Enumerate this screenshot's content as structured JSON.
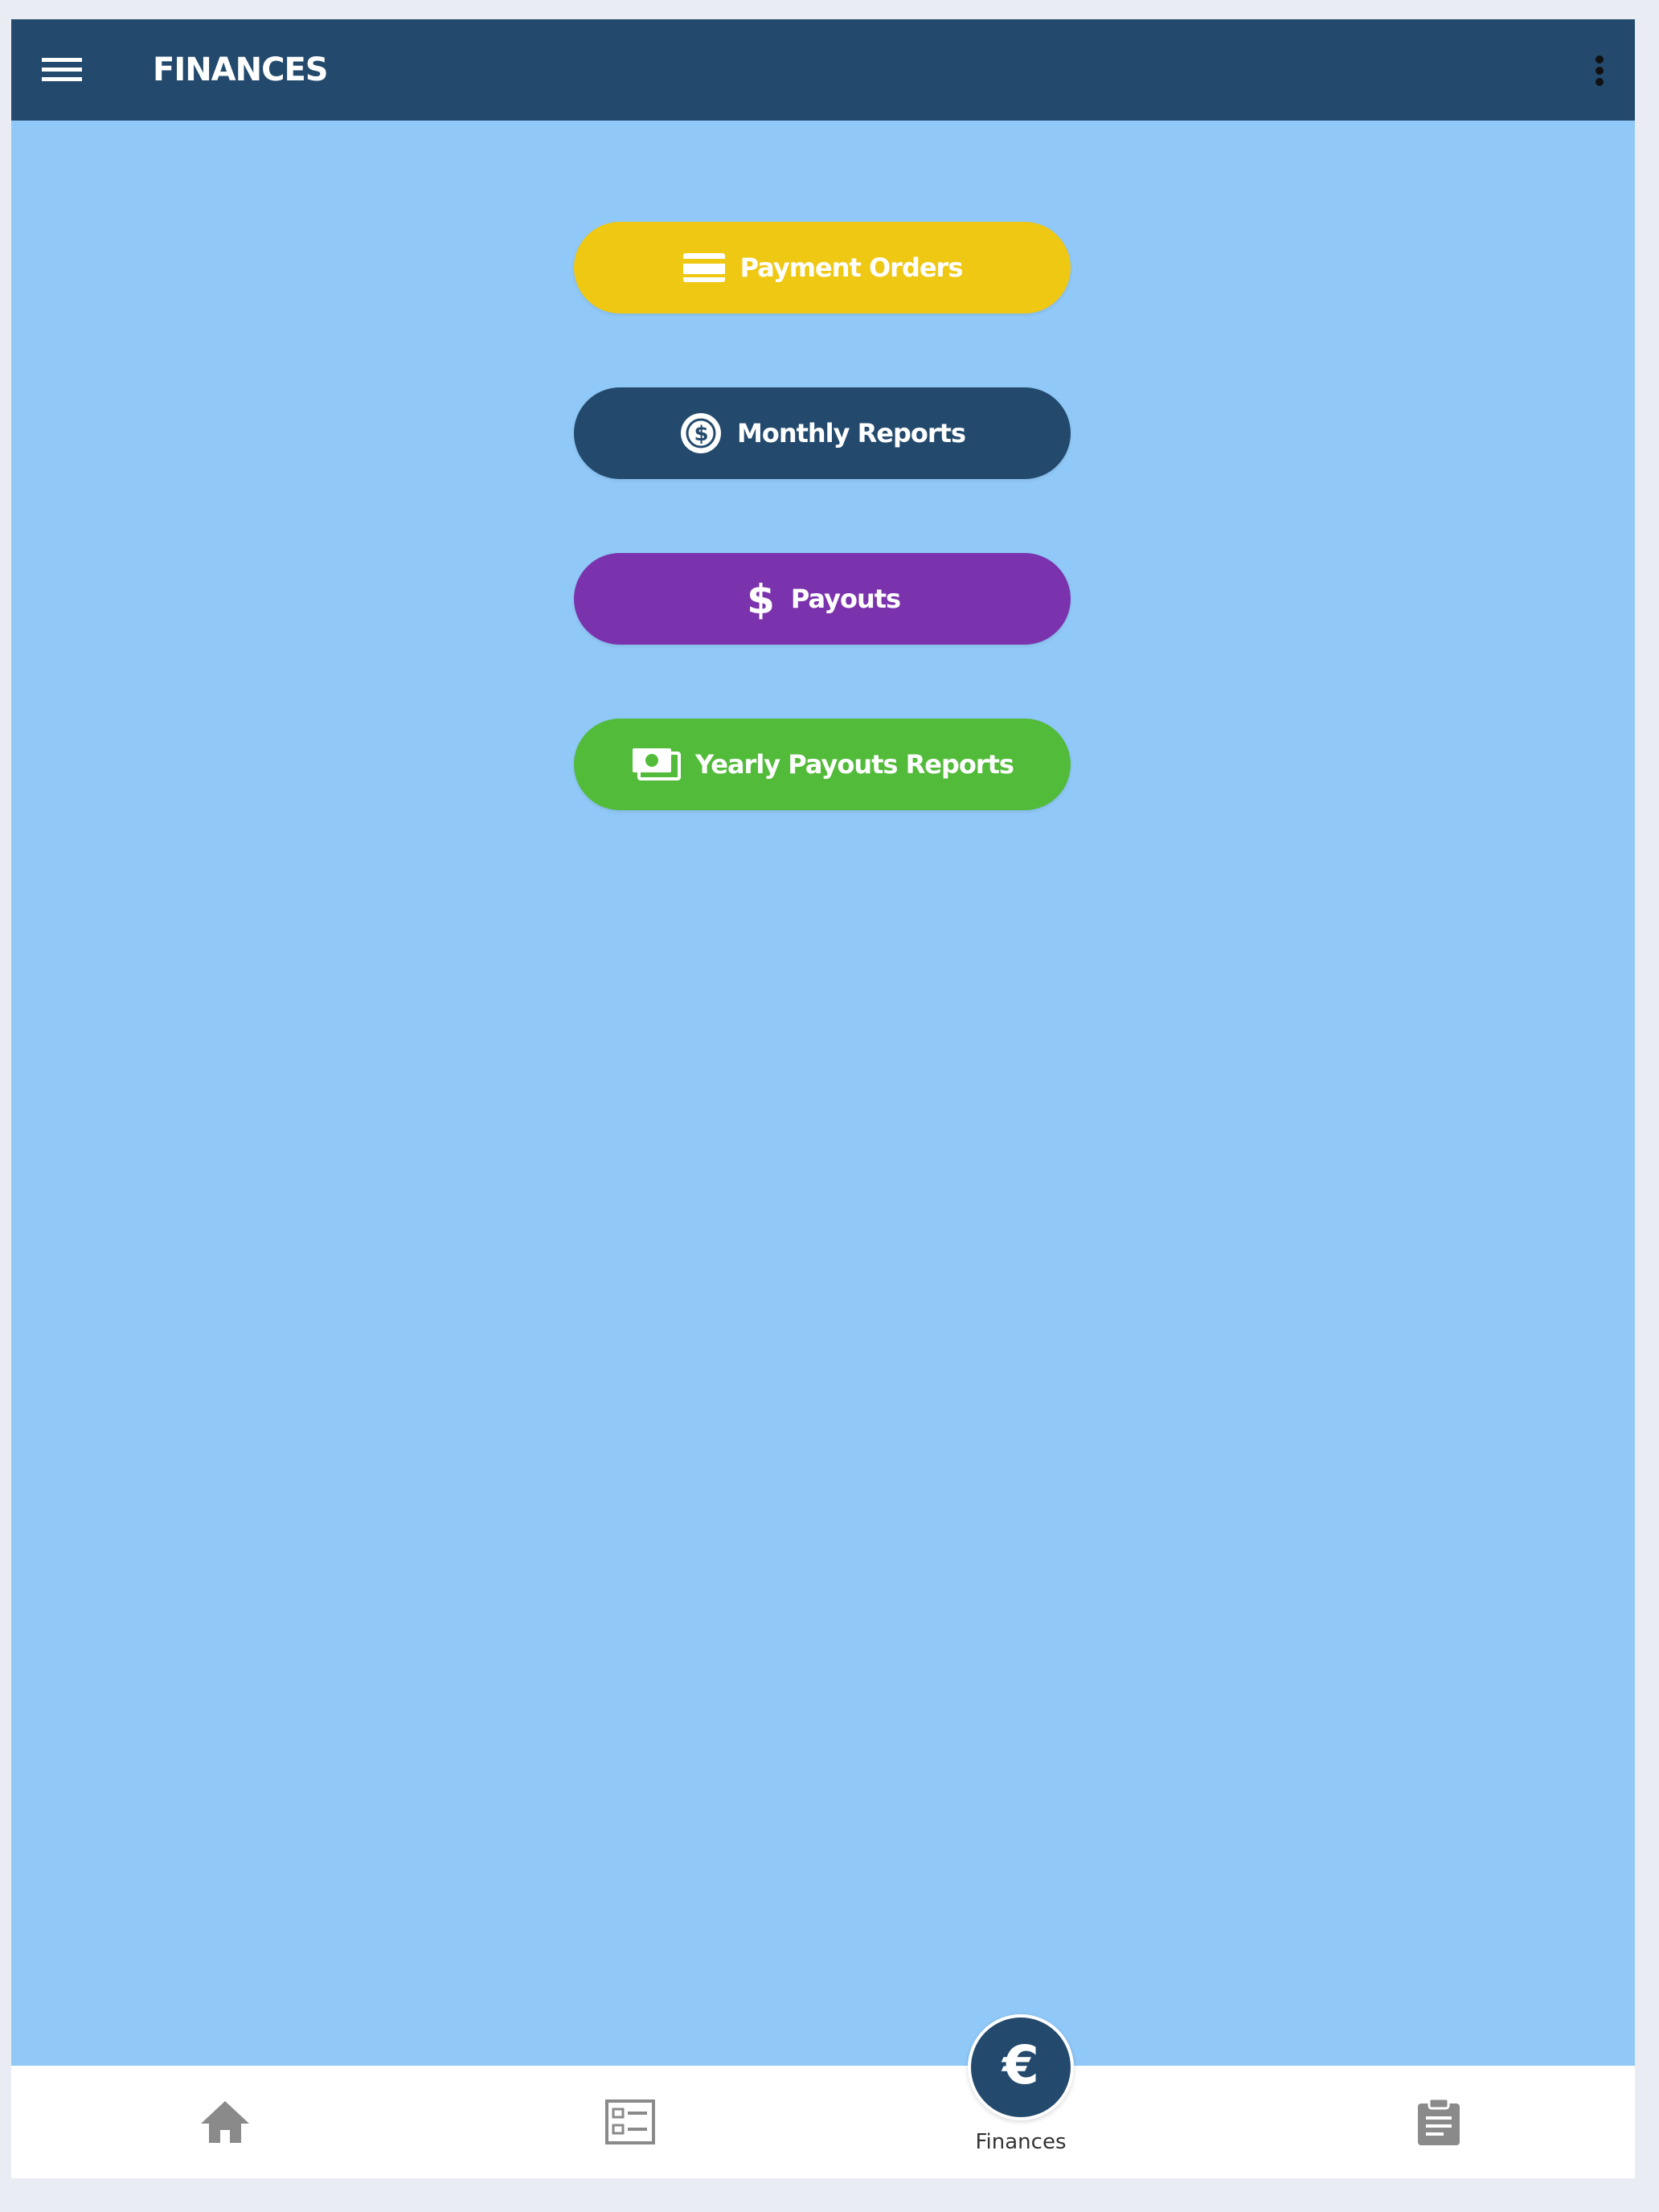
{
  "header": {
    "title": "FINANCES",
    "menu_icon": "hamburger-menu-icon",
    "more_icon": "vertical-dots-icon"
  },
  "actions": [
    {
      "label": "Payment Orders",
      "icon": "credit-card-icon",
      "color": "#efc814"
    },
    {
      "label": "Monthly Reports",
      "icon": "dollar-circle-icon",
      "color": "#234a6d"
    },
    {
      "label": "Payouts",
      "icon": "dollar-sign-icon",
      "color": "#7b33ad"
    },
    {
      "label": "Yearly Payouts Reports",
      "icon": "money-bills-icon",
      "color": "#52bb3a"
    }
  ],
  "bottom_nav": {
    "items": [
      {
        "icon": "home-icon"
      },
      {
        "icon": "checklist-icon"
      },
      {
        "icon": "euro-icon",
        "label": "Finances",
        "active": true
      },
      {
        "icon": "clipboard-icon"
      }
    ]
  },
  "colors": {
    "header_bg": "#234a6d",
    "page_bg": "#90c8f7",
    "nav_icon_inactive": "#8a8a8a"
  }
}
